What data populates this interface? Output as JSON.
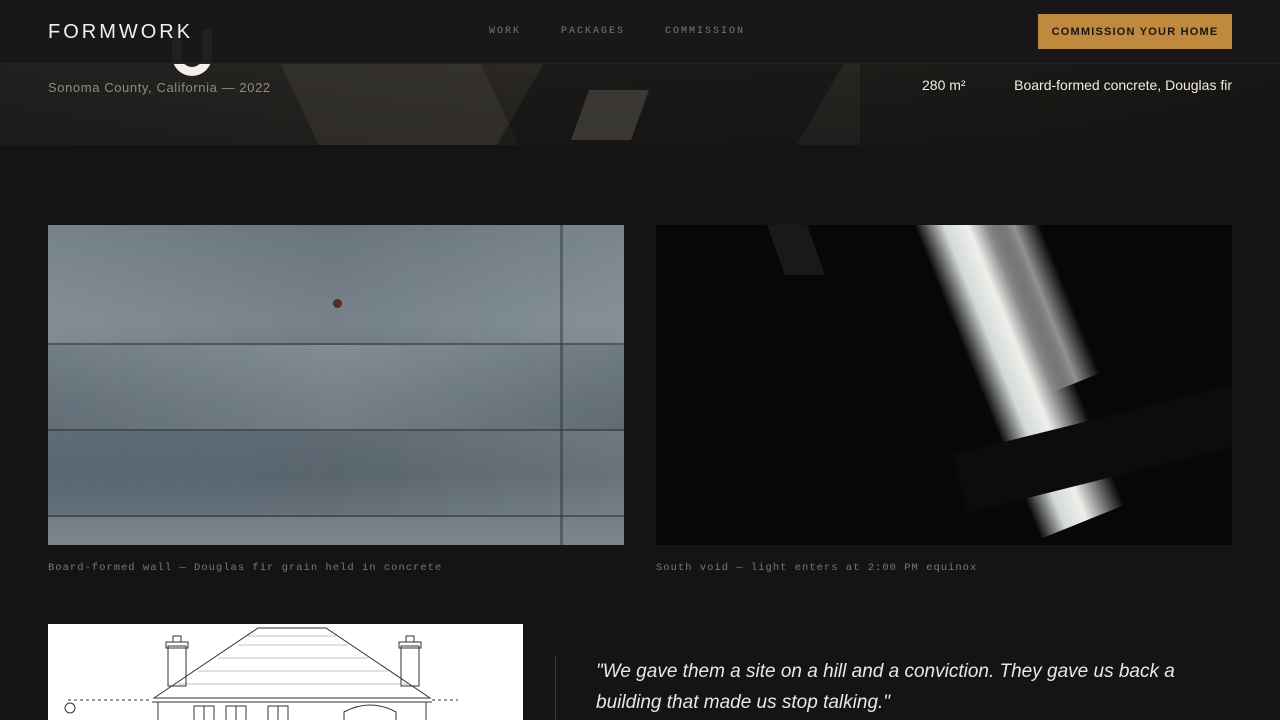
{
  "nav": {
    "logo": "FORMWORK",
    "links": [
      "WORK",
      "PACKAGES",
      "COMMISSION"
    ],
    "cta_label": "COMMISSION YOUR HOME",
    "accent_color": "#c08a3e"
  },
  "hero": {
    "location": "Sonoma County, California — 2022",
    "area": "280 m²",
    "materials": "Board-formed concrete, Douglas fir"
  },
  "gallery": [
    {
      "caption": "Board-formed wall — Douglas fir grain held in concrete"
    },
    {
      "caption": "South void — light enters at 2:00 PM equinox"
    }
  ],
  "quote": {
    "text": "\"We gave them a site on a hill and a conviction. They gave us back a building that made us stop talking.\""
  }
}
